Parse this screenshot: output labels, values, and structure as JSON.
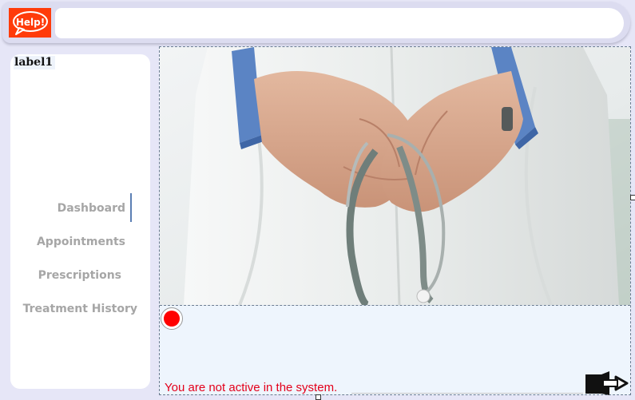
{
  "header": {
    "help_label": "Help!",
    "search_value": ""
  },
  "sidebar": {
    "title_label": "label1",
    "nav": [
      {
        "label": "Dashboard",
        "active": true
      },
      {
        "label": "Appointments",
        "active": false
      },
      {
        "label": "Prescriptions",
        "active": false
      },
      {
        "label": "Treatment History",
        "active": false
      }
    ]
  },
  "main": {
    "status_text": "You are not active in the system.",
    "status_color": "#ff0000",
    "exit_icon": "exit-door-arrow"
  },
  "colors": {
    "help_bg": "#ff3b0a",
    "nav_text": "#a6a6a6",
    "active_indicator": "#5b7fb4",
    "status_text": "#e3001b"
  }
}
